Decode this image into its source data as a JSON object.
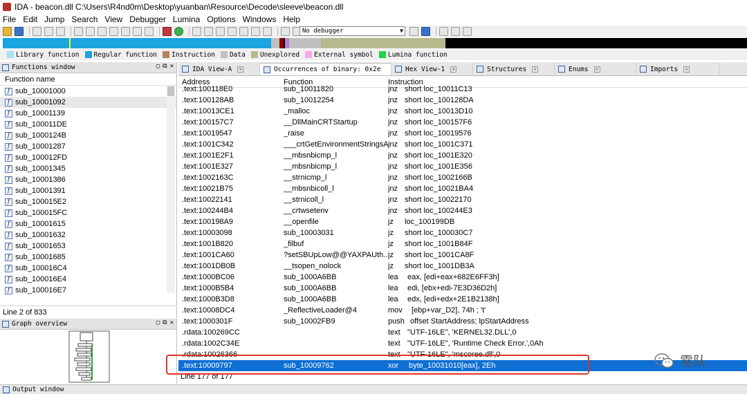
{
  "window": {
    "title": "IDA - beacon.dll C:\\Users\\R4nd0m\\Desktop\\yuanban\\Resource\\Decode\\sleeve\\beacon.dll"
  },
  "menu": [
    "File",
    "Edit",
    "Jump",
    "Search",
    "View",
    "Debugger",
    "Lumina",
    "Options",
    "Windows",
    "Help"
  ],
  "toolbar": {
    "debugger_select": "No debugger"
  },
  "legend": [
    {
      "label": "Library function",
      "color": "#a6e3f2"
    },
    {
      "label": "Regular function",
      "color": "#1aa4e0"
    },
    {
      "label": "Instruction",
      "color": "#b5835a"
    },
    {
      "label": "Data",
      "color": "#c0c0c0"
    },
    {
      "label": "Unexplored",
      "color": "#b8b88e"
    },
    {
      "label": "External symbol",
      "color": "#f7a8e8"
    },
    {
      "label": "Lumina function",
      "color": "#24d04a"
    }
  ],
  "functions_window": {
    "title": "Functions window",
    "column": "Function name",
    "items": [
      "sub_10001000",
      "sub_10001092",
      "sub_10001139",
      "sub_100011DE",
      "sub_1000124B",
      "sub_10001287",
      "sub_100012FD",
      "sub_10001345",
      "sub_10001386",
      "sub_10001391",
      "sub_100015E2",
      "sub_100015FC",
      "sub_10001615",
      "sub_10001632",
      "sub_10001653",
      "sub_10001685",
      "sub_100016C4",
      "sub_100016E4",
      "sub_100016E7"
    ],
    "selected_index": 1,
    "status": "Line 2 of 833"
  },
  "graph_overview": {
    "title": "Graph overview"
  },
  "output_window": {
    "title": "Output window"
  },
  "tabs": [
    {
      "label": "IDA View-A",
      "active": false
    },
    {
      "label": "Occurrences of binary: 0x2e",
      "active": true
    },
    {
      "label": "Hex View-1",
      "active": false
    },
    {
      "label": "Structures",
      "active": false
    },
    {
      "label": "Enums",
      "active": false
    },
    {
      "label": "Imports",
      "active": false
    }
  ],
  "occurrences": {
    "columns": [
      "Address",
      "Function",
      "Instruction"
    ],
    "rows": [
      {
        "address": ".text:100118E0",
        "function": "sub_10011820",
        "mnemonic": "jnz",
        "operands": "short loc_10011C13"
      },
      {
        "address": ".text:100128AB",
        "function": "sub_10012254",
        "mnemonic": "jnz",
        "operands": "short loc_100128DA"
      },
      {
        "address": ".text:10013CE1",
        "function": "_malloc",
        "mnemonic": "jnz",
        "operands": "short loc_10013D10"
      },
      {
        "address": ".text:100157C7",
        "function": "__DllMainCRTStartup",
        "mnemonic": "jnz",
        "operands": "short loc_100157F6"
      },
      {
        "address": ".text:10019547",
        "function": "_raise",
        "mnemonic": "jnz",
        "operands": "short loc_10019576"
      },
      {
        "address": ".text:1001C342",
        "function": "___crtGetEnvironmentStringsA",
        "mnemonic": "jnz",
        "operands": "short loc_1001C371"
      },
      {
        "address": ".text:1001E2F1",
        "function": "__mbsnbicmp_l",
        "mnemonic": "jnz",
        "operands": "short loc_1001E320"
      },
      {
        "address": ".text:1001E327",
        "function": "__mbsnbicmp_l",
        "mnemonic": "jnz",
        "operands": "short loc_1001E356"
      },
      {
        "address": ".text:1002163C",
        "function": "__strnicmp_l",
        "mnemonic": "jnz",
        "operands": "short loc_1002166B"
      },
      {
        "address": ".text:10021B75",
        "function": "__mbsnbicoll_l",
        "mnemonic": "jnz",
        "operands": "short loc_10021BA4"
      },
      {
        "address": ".text:10022141",
        "function": "__strnicoll_l",
        "mnemonic": "jnz",
        "operands": "short loc_10022170"
      },
      {
        "address": ".text:100244B4",
        "function": "__crtwsetenv",
        "mnemonic": "jnz",
        "operands": "short loc_100244E3"
      },
      {
        "address": ".text:100198A9",
        "function": "__openfile",
        "mnemonic": "jz",
        "operands": "loc_100199DB"
      },
      {
        "address": ".text:10003098",
        "function": "sub_10003031",
        "mnemonic": "jz",
        "operands": "short loc_100030C7"
      },
      {
        "address": ".text:1001B820",
        "function": "_filbuf",
        "mnemonic": "jz",
        "operands": "short loc_1001B84F"
      },
      {
        "address": ".text:1001CA60",
        "function": "?setSBUpLow@@YAXPAUth...",
        "mnemonic": "jz",
        "operands": "short loc_1001CA8F"
      },
      {
        "address": ".text:1001DB0B",
        "function": "__tsopen_nolock",
        "mnemonic": "jz",
        "operands": "short loc_1001DB3A"
      },
      {
        "address": ".text:1000BC06",
        "function": "sub_1000A6BB",
        "mnemonic": "lea",
        "operands": "eax, [edi+eax+682E6FF3h]"
      },
      {
        "address": ".text:1000B5B4",
        "function": "sub_1000A6BB",
        "mnemonic": "lea",
        "operands": "edi, [ebx+edi-7E3D36D2h]"
      },
      {
        "address": ".text:1000B3D8",
        "function": "sub_1000A6BB",
        "mnemonic": "lea",
        "operands": "edx, [edi+edx+2E1B2138h]"
      },
      {
        "address": ".text:10008DC4",
        "function": "_ReflectiveLoader@4",
        "mnemonic": "mov",
        "operands": "[ebp+var_D2], 74h ; 't'"
      },
      {
        "address": ".text:1000301F",
        "function": "sub_10002FB9",
        "mnemonic": "push",
        "operands": "offset StartAddress; lpStartAddress"
      },
      {
        "address": ".rdata:100269CC",
        "function": "",
        "mnemonic": "text",
        "operands": "\"UTF-16LE\", 'KERNEL32.DLL',0"
      },
      {
        "address": ".rdata:1002C34E",
        "function": "",
        "mnemonic": "text",
        "operands": "\"UTF-16LE\", 'Runtime Check Error.',0Ah"
      },
      {
        "address": ".rdata:10026366",
        "function": "",
        "mnemonic": "text",
        "operands": "\"UTF-16LE\", 'mscoree.dll',0"
      },
      {
        "address": ".text:10009797",
        "function": "sub_10009762",
        "mnemonic": "xor",
        "operands": "byte_10031010[eax], 2Eh"
      }
    ],
    "selected_index": 25,
    "status": "Line 177 of 177"
  },
  "watermark": {
    "text": "零队"
  }
}
